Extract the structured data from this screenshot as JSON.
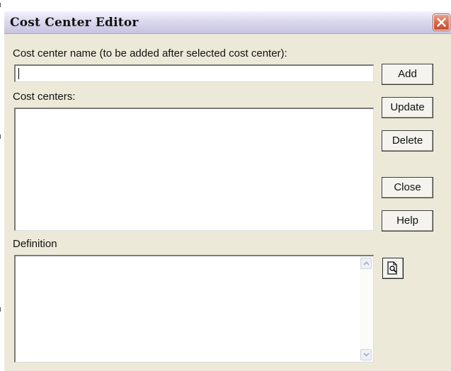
{
  "window": {
    "title": "Cost Center Editor"
  },
  "name_field": {
    "label": "Cost center name (to be added after selected cost center):",
    "value": ""
  },
  "cost_centers": {
    "label": "Cost centers:",
    "items": []
  },
  "definition": {
    "label": "Definition",
    "value": ""
  },
  "buttons": {
    "add": "Add",
    "update": "Update",
    "delete": "Delete",
    "close": "Close",
    "help": "Help"
  },
  "icons": {
    "close": "close-x-icon",
    "preview": "print-preview-icon",
    "scroll_up": "chevron-up-icon",
    "scroll_down": "chevron-down-icon"
  },
  "colors": {
    "window_bg": "#ece9d8",
    "close_button": "#d86a4e"
  }
}
